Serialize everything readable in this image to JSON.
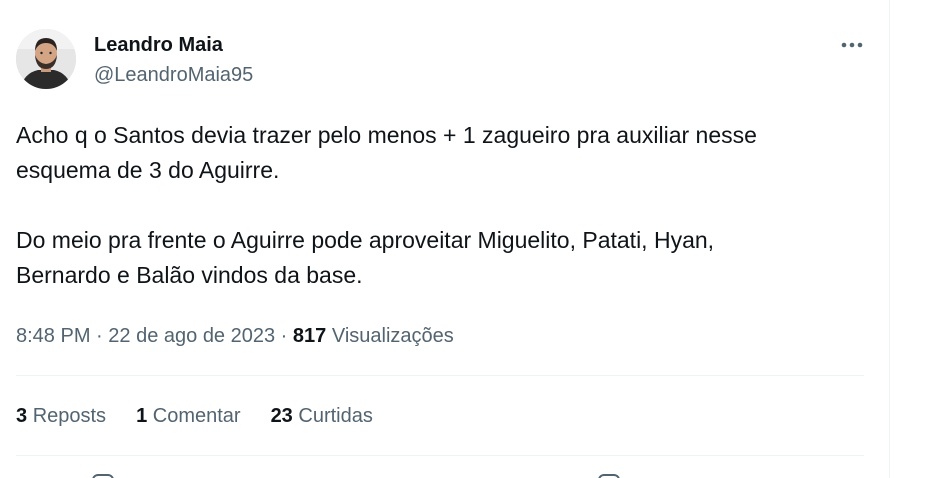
{
  "author": {
    "name": "Leandro Maia",
    "handle": "@LeandroMaia95",
    "avatar": "profile-photo"
  },
  "tweet": {
    "paragraphs": [
      "Acho q o Santos devia trazer pelo menos + 1 zagueiro pra auxiliar nesse\nesquema de 3 do Aguirre.",
      "Do meio pra frente o Aguirre pode aproveitar Miguelito, Patati, Hyan,\nBernardo e Balão vindos da base."
    ],
    "time": "8:48 PM",
    "separator": "·",
    "date": "22 de ago de 2023",
    "views_count": "817",
    "views_label": "Visualizações"
  },
  "stats": {
    "reposts_count": "3",
    "reposts_label": "Reposts",
    "comments_count": "1",
    "comments_label": "Comentar",
    "likes_count": "23",
    "likes_label": "Curtidas"
  },
  "icons": {
    "more": "more-horizontal-icon"
  },
  "colors": {
    "text_primary": "#0f1419",
    "text_secondary": "#536471",
    "divider": "#eff3f4"
  }
}
